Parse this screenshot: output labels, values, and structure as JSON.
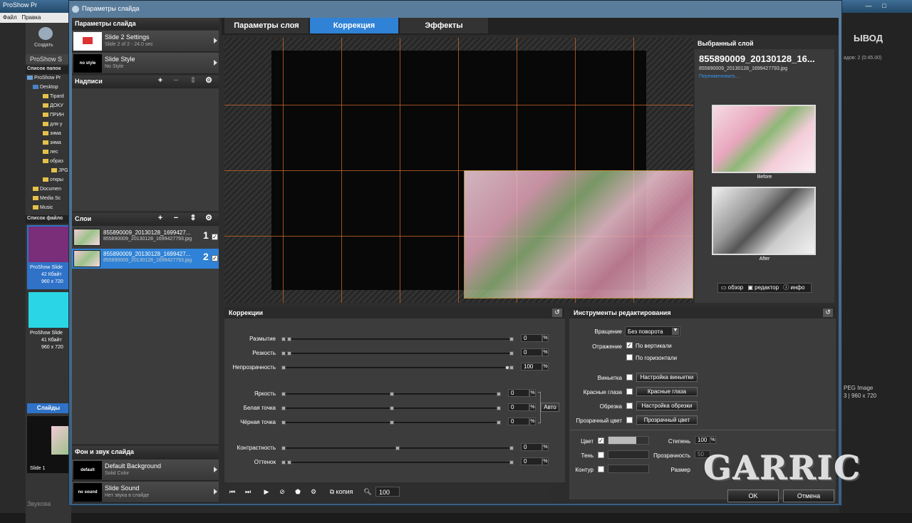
{
  "bg_app": {
    "title": "ProShow Pr",
    "menu": [
      "Файл",
      "Правка"
    ],
    "create_label": "Создать",
    "app_label": "ProShow S",
    "folders_header": "Список папок",
    "tree": [
      "ProShow Pr",
      "Desktop",
      "Tipard",
      "ДОКУ",
      "ПРИН",
      "для у",
      "зима",
      "зима",
      "лес",
      "образ",
      "JPG",
      "откры",
      "Documen",
      "Media Sc",
      "Music"
    ],
    "files_header": "Список файло",
    "file1": {
      "name": "ProShow Slide",
      "size": "42 Кбайт",
      "dims": "960 x 720"
    },
    "file2": {
      "name": "ProShow Slide",
      "size": "41 Кбайт",
      "dims": "960 x 720"
    },
    "slides_tab": "Слайды",
    "slide1": "Slide 1",
    "bottom_text": "Звукова",
    "right_vyvod": "ЫВОД",
    "right_count": "адов: 2 (0:45.00)",
    "right_jpeg": "PEG Image",
    "right_dims": "3 | 960 x 720"
  },
  "dialog": {
    "title": "Параметры слайда",
    "left": {
      "header": "Параметры слайда",
      "slide_settings": {
        "title": "Slide 2 Settings",
        "sub": "Slide 2 of 2 - 24.0 sec"
      },
      "slide_style": {
        "thumb": "no style",
        "title": "Slide Style",
        "sub": "No Style"
      },
      "captions_header": "Надписи",
      "layers_header": "Слои",
      "layers": [
        {
          "name": "855890009_20130128_1699427...",
          "file": "855890009_20130128_1699427793.jpg",
          "num": "1",
          "check": "✓"
        },
        {
          "name": "855890009_20130128_1699427...",
          "file": "855890009_20130128_1699427793.jpg",
          "num": "2",
          "check": "✓"
        }
      ],
      "bg_header": "Фон и звук слайда",
      "bg": {
        "thumb": "default",
        "title": "Default Background",
        "sub": "Solid Color"
      },
      "sound": {
        "thumb": "no sound",
        "title": "Slide Sound",
        "sub": "Нет звука в слайде"
      }
    },
    "tabs": [
      "Параметры слоя",
      "Коррекция",
      "Эффекты"
    ],
    "selected": {
      "header": "Выбранный слой",
      "name": "855890009_20130128_16...",
      "file": "855890009_20130128_1699427793.jpg",
      "rename": "Переименовать...",
      "before": "Before",
      "after": "After",
      "actions": [
        "обзор",
        "редактор",
        "инфо"
      ]
    },
    "corrections": {
      "header": "Коррекции",
      "rows": [
        {
          "label": "Размытие",
          "value": "0",
          "pct": "%"
        },
        {
          "label": "Резкость",
          "value": "0",
          "pct": "%"
        },
        {
          "label": "Непрозрачность",
          "value": "100",
          "pct": "%"
        },
        {
          "label": "Яркость",
          "value": "0",
          "pct": "%"
        },
        {
          "label": "Белая точка",
          "value": "0",
          "pct": "%"
        },
        {
          "label": "Чёрная точка",
          "value": "0",
          "pct": "%"
        },
        {
          "label": "Контрастность",
          "value": "0",
          "pct": "%"
        },
        {
          "label": "Оттенок",
          "value": "0",
          "pct": "%"
        }
      ],
      "auto": "Авто"
    },
    "tools": {
      "header": "Инструменты редактирования",
      "rotation_label": "Вращение",
      "rotation_value": "Без поворота",
      "reflection_label": "Отражение",
      "vertical": "По вертикали",
      "horizontal": "По горизонтали",
      "vignette_label": "Виньетка",
      "vignette_btn": "Настройка виньетки",
      "redeye_label": "Красные глаза",
      "redeye_btn": "Красные глаза",
      "crop_label": "Обрезка",
      "crop_btn": "Настройка обрезки",
      "transparent_label": "Прозрачный цвет",
      "transparent_btn": "Прозрачный цвет",
      "color_label": "Цвет",
      "shadow_label": "Тень",
      "outline_label": "Контур",
      "degree_label": "Степень",
      "degree_value": "100",
      "transparency_label": "Прозрачность",
      "transparency_value": "50",
      "size_label": "Размер"
    },
    "bottom": {
      "copy": "копия",
      "zoom": "100"
    },
    "ok": "OK",
    "cancel": "Отмена"
  },
  "watermark": "GARRIC"
}
